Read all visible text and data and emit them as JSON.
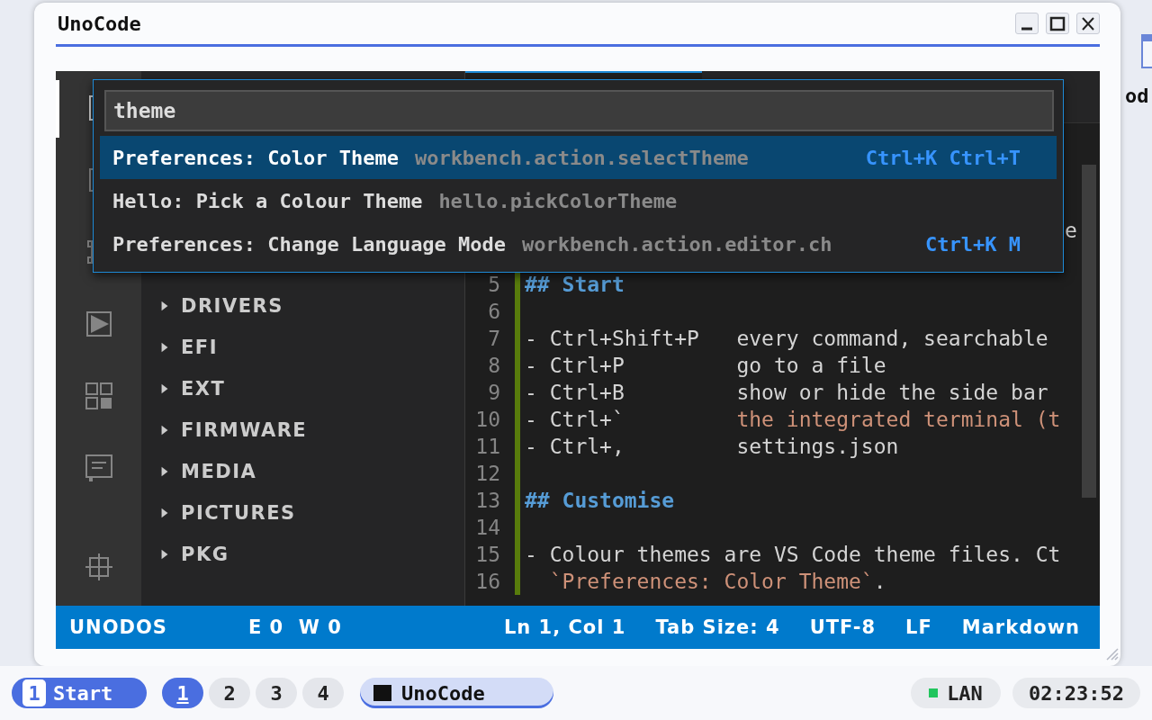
{
  "window": {
    "title": "UnoCode"
  },
  "activity_bar": {
    "items": [
      {
        "kind": "files",
        "selected": true
      },
      {
        "kind": "search",
        "selected": false
      },
      {
        "kind": "source-control",
        "selected": false
      },
      {
        "kind": "run",
        "selected": false
      },
      {
        "kind": "extensions",
        "selected": false
      },
      {
        "kind": "comments",
        "selected": false
      },
      {
        "kind": "remote",
        "selected": false
      }
    ]
  },
  "sidebar": {
    "tree": [
      {
        "label": "DRIVERS",
        "expanded": false
      },
      {
        "label": "EFI",
        "expanded": false
      },
      {
        "label": "EXT",
        "expanded": false
      },
      {
        "label": "FIRMWARE",
        "expanded": false
      },
      {
        "label": "MEDIA",
        "expanded": false
      },
      {
        "label": "PICTURES",
        "expanded": false
      },
      {
        "label": "PKG",
        "expanded": false
      }
    ]
  },
  "editor": {
    "fragment": "e",
    "lines": [
      {
        "number": "5",
        "segments": [
          {
            "kind": "heading",
            "text": "## Start"
          }
        ]
      },
      {
        "number": "6"
      },
      {
        "number": "7",
        "segments": [
          {
            "kind": "plain",
            "text": "- Ctrl+Shift+P   every command, searchable"
          }
        ]
      },
      {
        "number": "8",
        "segments": [
          {
            "kind": "plain",
            "text": "- Ctrl+P         go to a file"
          }
        ]
      },
      {
        "number": "9",
        "segments": [
          {
            "kind": "plain",
            "text": "- Ctrl+B         show or hide the side bar"
          }
        ]
      },
      {
        "number": "10",
        "segments": [
          {
            "kind": "plain",
            "text": "- Ctrl+`         "
          },
          {
            "kind": "code",
            "text": "the integrated terminal (t"
          }
        ]
      },
      {
        "number": "11",
        "segments": [
          {
            "kind": "plain",
            "text": "- Ctrl+,         settings.json"
          }
        ]
      },
      {
        "number": "12"
      },
      {
        "number": "13",
        "segments": [
          {
            "kind": "heading",
            "text": "## Customise"
          }
        ]
      },
      {
        "number": "14"
      },
      {
        "number": "15",
        "segments": [
          {
            "kind": "plain",
            "text": "- Colour themes are VS Code theme files. Ct"
          }
        ]
      },
      {
        "number": "16",
        "segments": [
          {
            "kind": "code",
            "text": "  `Preferences: Color Theme`"
          },
          {
            "kind": "plain",
            "text": "."
          }
        ]
      }
    ]
  },
  "command_palette": {
    "value": "theme",
    "items": [
      {
        "label": "Preferences: Color Theme",
        "command": "workbench.action.selectTheme",
        "keybinding": "Ctrl+K Ctrl+T",
        "selected": true
      },
      {
        "label": "Hello: Pick a Colour Theme",
        "command": "hello.pickColorTheme",
        "selected": false
      },
      {
        "label": "Preferences: Change Language Mode",
        "command": "workbench.action.editor.ch",
        "keybinding": "Ctrl+K M",
        "selected": false
      }
    ]
  },
  "status_bar": {
    "left": [
      "UNODOS",
      "E 0  W 0"
    ],
    "right": [
      "Ln 1, Col 1",
      "Tab Size: 4",
      "UTF-8",
      "LF",
      "Markdown"
    ]
  },
  "taskbar": {
    "start": {
      "badge": "1",
      "label": "Start"
    },
    "workspaces": [
      {
        "label": "1",
        "selected": true
      },
      {
        "label": "2",
        "selected": false
      },
      {
        "label": "3",
        "selected": false
      },
      {
        "label": "4",
        "selected": false
      }
    ],
    "tasks": [
      {
        "label": "UnoCode",
        "selected": true
      }
    ],
    "network": {
      "label": "LAN",
      "online": true
    },
    "clock": "02:23:52"
  },
  "desktop_icons": [
    {
      "label": "od"
    }
  ]
}
